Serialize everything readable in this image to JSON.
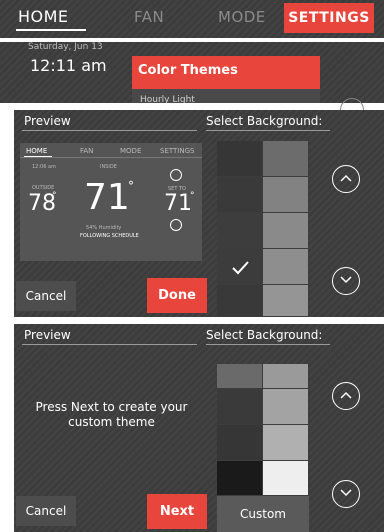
{
  "nav": {
    "tabs": [
      "HOME",
      "FAN",
      "MODE",
      "SETTINGS"
    ],
    "active": "SETTINGS"
  },
  "panel2": {
    "date": "Saturday, Jun 13",
    "time": "12:11 am",
    "menu_item_1": "Color Themes",
    "menu_item_2": "Hourly Light"
  },
  "panel3": {
    "preview_label": "Preview",
    "select_label": "Select Background:",
    "cancel": "Cancel",
    "done": "Done",
    "preview": {
      "tabs": [
        "HOME",
        "FAN",
        "MODE",
        "SETTINGS"
      ],
      "time": "12:06 am",
      "inside_label": "INSIDE",
      "outside_label": "OUTSIDE",
      "outside_temp": "78",
      "inside_temp": "71",
      "set_to_label": "SET TO",
      "set_temp": "71",
      "humidity": "54% Humidity",
      "schedule": "FOLLOWING SCHEDULE"
    },
    "selected_index": 3
  },
  "panel4": {
    "preview_label": "Preview",
    "select_label": "Select Background:",
    "message": "Press Next to create your custom theme",
    "cancel": "Cancel",
    "next": "Next",
    "custom": "Custom"
  },
  "colors": {
    "accent": "#e8453c",
    "panel": "#3c3c3c"
  }
}
